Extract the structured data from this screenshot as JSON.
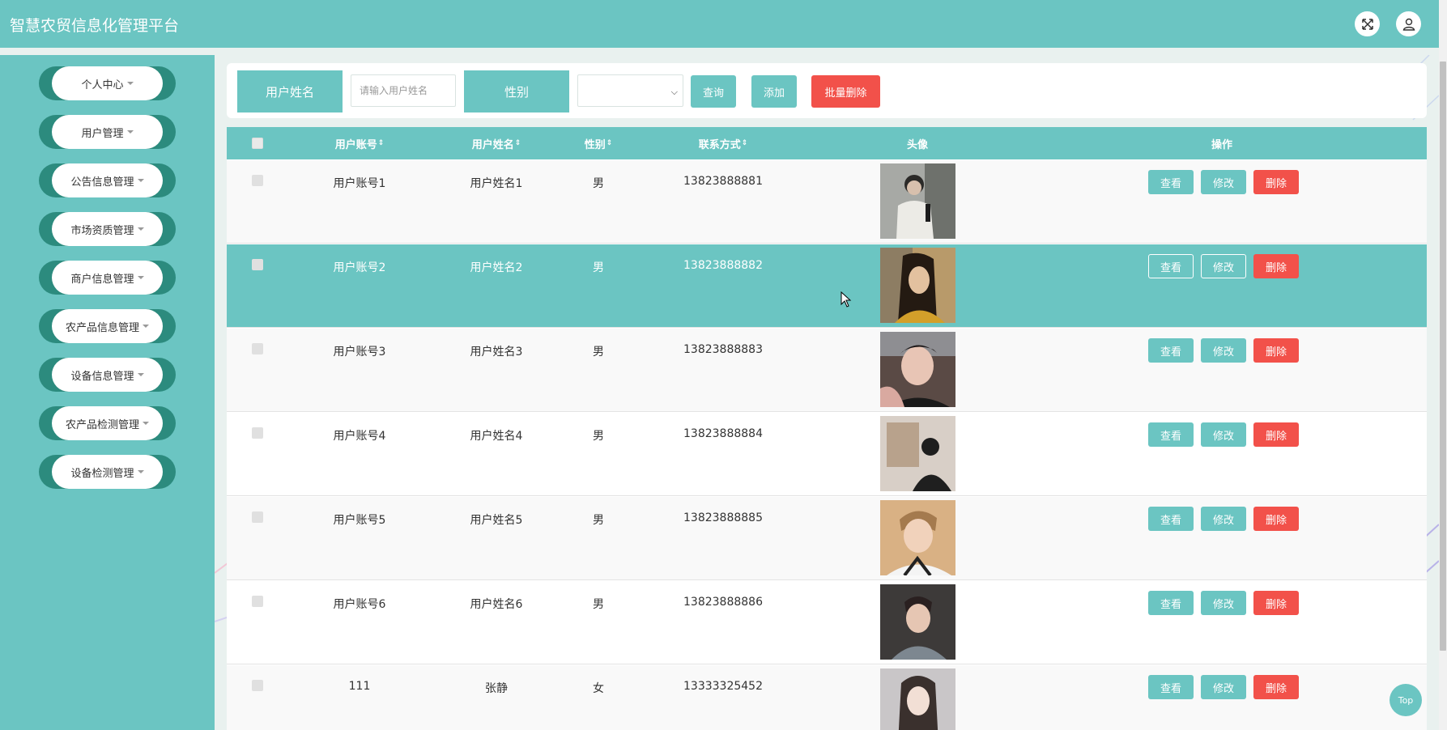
{
  "app": {
    "title": "智慧农贸信息化管理平台"
  },
  "header": {
    "fullscreen_icon": "fullscreen-icon",
    "user_icon": "user-icon"
  },
  "sidebar": {
    "items": [
      {
        "label": "个人中心"
      },
      {
        "label": "用户管理"
      },
      {
        "label": "公告信息管理"
      },
      {
        "label": "市场资质管理"
      },
      {
        "label": "商户信息管理"
      },
      {
        "label": "农产品信息管理"
      },
      {
        "label": "设备信息管理"
      },
      {
        "label": "农产品检测管理"
      },
      {
        "label": "设备检测管理"
      }
    ]
  },
  "search": {
    "name_label": "用户姓名",
    "name_placeholder": "请输入用户姓名",
    "gender_label": "性别",
    "gender_value": "",
    "query_label": "查询",
    "add_label": "添加",
    "batch_delete_label": "批量删除"
  },
  "table": {
    "columns": {
      "account": "用户账号",
      "name": "用户姓名",
      "gender": "性别",
      "phone": "联系方式",
      "avatar": "头像",
      "actions": "操作"
    },
    "sort_arrow": "⇕",
    "rows": [
      {
        "account": "用户账号1",
        "name": "用户姓名1",
        "gender": "男",
        "phone": "13823888881"
      },
      {
        "account": "用户账号2",
        "name": "用户姓名2",
        "gender": "男",
        "phone": "13823888882"
      },
      {
        "account": "用户账号3",
        "name": "用户姓名3",
        "gender": "男",
        "phone": "13823888883"
      },
      {
        "account": "用户账号4",
        "name": "用户姓名4",
        "gender": "男",
        "phone": "13823888884"
      },
      {
        "account": "用户账号5",
        "name": "用户姓名5",
        "gender": "男",
        "phone": "13823888885"
      },
      {
        "account": "用户账号6",
        "name": "用户姓名6",
        "gender": "男",
        "phone": "13823888886"
      },
      {
        "account": "111",
        "name": "张静",
        "gender": "女",
        "phone": "13333325452"
      }
    ],
    "actions": {
      "view": "查看",
      "edit": "修改",
      "delete": "删除"
    }
  },
  "top_button": {
    "label": "Top"
  },
  "colors": {
    "primary": "#6bc5c2",
    "danger": "#f2514a",
    "sidebar_pill": "#2c8b7e"
  }
}
